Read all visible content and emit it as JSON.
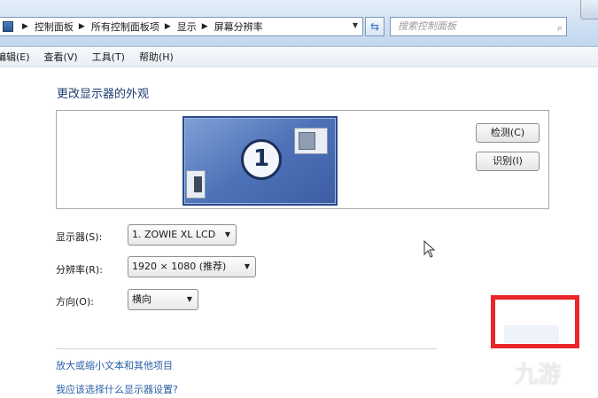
{
  "address_bar": {
    "breadcrumbs": [
      "控制面板",
      "所有控制面板项",
      "显示",
      "屏幕分辨率"
    ],
    "search_placeholder": "搜索控制面板"
  },
  "menu": [
    "编辑(E)",
    "查看(V)",
    "工具(T)",
    "帮助(H)"
  ],
  "page_title": "更改显示器的外观",
  "monitor_preview": {
    "number": "1"
  },
  "buttons": {
    "detect": "检测(C)",
    "identify": "识别(I)"
  },
  "fields": {
    "display_label": "显示器(S):",
    "display_value": "1. ZOWIE XL LCD",
    "resolution_label": "分辨率(R):",
    "resolution_value": "1920 × 1080 (推荐)",
    "orientation_label": "方向(O):",
    "orientation_value": "横向"
  },
  "links": {
    "text_size": "放大或缩小文本和其他项目",
    "which_settings": "我应该选择什么显示器设置?"
  },
  "highlight_button_label": "",
  "watermark": "九游",
  "colors": {
    "accent_link": "#2a5ea6",
    "highlight": "#e8262b",
    "monitor": "#4e72b8"
  }
}
